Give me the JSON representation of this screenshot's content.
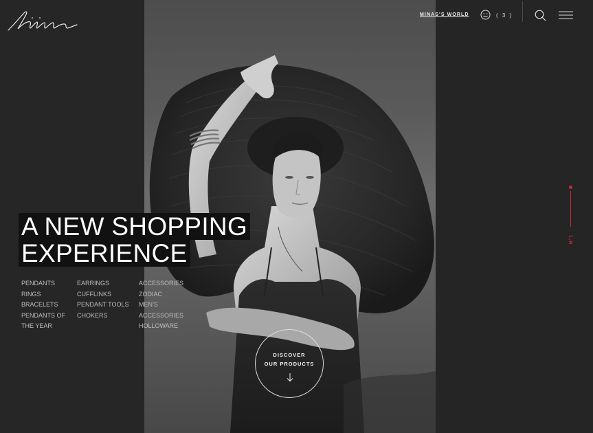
{
  "brand": {
    "logo_text": "Minas"
  },
  "header": {
    "world_link": "MINAS'S WORLD",
    "cart_count": "( 3 )",
    "icons": {
      "account": "smiley-icon",
      "search": "search-icon",
      "menu": "hamburger-menu-icon"
    }
  },
  "hero": {
    "headline_line1": "A NEW SHOPPING",
    "headline_line2": "EXPERIENCE",
    "cta_line1": "DISCOVER",
    "cta_line2": "OUR PRODUCTS"
  },
  "categories": {
    "col1": [
      "PENDANTS",
      "RINGS",
      "BRACELETS",
      "PENDANTS OF THE YEAR"
    ],
    "col2": [
      "EARRINGS",
      "CUFFLINKS",
      "PENDANT TOOLS",
      "CHOKERS"
    ],
    "col3": [
      "ACCESSORIES",
      "ZODIAC",
      "MEN'S",
      "ACCESSORIES HOLLOWARE"
    ]
  },
  "slider": {
    "label": "N°1"
  },
  "colors": {
    "accent": "#c8283a",
    "background": "#232323"
  }
}
